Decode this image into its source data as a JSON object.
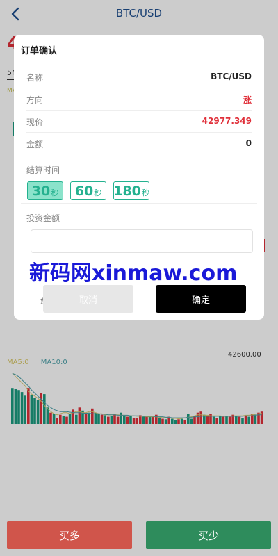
{
  "header": {
    "title": "BTC/USD",
    "back_icon": "chevron-left-icon"
  },
  "background": {
    "price_partial": "4",
    "period_partial": "5M",
    "ma_top_partial": "MA",
    "axis_label": "42600.00",
    "ma5_label": "MA5:0",
    "ma10_label": "MA10:0"
  },
  "volume_chart": {
    "type": "bar",
    "values": [
      70,
      68,
      66,
      62,
      55,
      70,
      56,
      50,
      46,
      60,
      58,
      32,
      22,
      20,
      12,
      18,
      15,
      14,
      20,
      28,
      18,
      32,
      26,
      20,
      22,
      30,
      22,
      20,
      18,
      17,
      14,
      16,
      20,
      14,
      22,
      15,
      14,
      16,
      12,
      12,
      17,
      14,
      15,
      14,
      14,
      18,
      12,
      10,
      9,
      14,
      10,
      8,
      9,
      10,
      8,
      20,
      10,
      16,
      22,
      24,
      18,
      16,
      20,
      14,
      12,
      16,
      14,
      15,
      14,
      18,
      16,
      14,
      12,
      16,
      14,
      20,
      18,
      22,
      24
    ],
    "colors": [
      "g",
      "g",
      "g",
      "g",
      "g",
      "r",
      "g",
      "g",
      "g",
      "r",
      "g",
      "g",
      "r",
      "g",
      "r",
      "r",
      "g",
      "r",
      "g",
      "r",
      "g",
      "r",
      "g",
      "r",
      "g",
      "r",
      "g",
      "g",
      "r",
      "g",
      "r",
      "g",
      "r",
      "r",
      "g",
      "g",
      "r",
      "g",
      "r",
      "r",
      "r",
      "g",
      "r",
      "g",
      "r",
      "r",
      "g",
      "r",
      "g",
      "r",
      "g",
      "g",
      "r",
      "g",
      "r",
      "g",
      "g",
      "r",
      "r",
      "r",
      "g",
      "r",
      "r",
      "g",
      "r",
      "g",
      "r",
      "g",
      "r",
      "r",
      "g",
      "r",
      "g",
      "r",
      "g",
      "r",
      "g",
      "r",
      "r"
    ],
    "ma5": [
      100,
      92,
      86,
      80,
      74,
      64,
      58,
      54,
      50,
      44,
      36,
      30,
      24,
      20,
      18,
      20,
      22,
      22,
      20,
      22,
      24,
      24,
      22,
      22,
      24,
      24,
      22,
      20,
      20,
      18,
      18,
      18,
      18,
      18,
      17,
      17,
      16,
      16,
      16,
      15,
      15,
      15,
      14,
      14,
      14,
      14,
      13,
      12,
      12,
      12,
      11,
      11,
      10,
      11,
      12,
      13,
      14,
      16,
      18,
      18,
      17,
      17,
      16,
      16,
      16,
      16,
      15,
      15,
      15,
      16,
      16,
      16,
      16,
      17,
      17,
      18,
      19,
      20,
      21
    ],
    "ma10": [
      98,
      96,
      92,
      86,
      80,
      74,
      66,
      60,
      54,
      48,
      42,
      36,
      32,
      28,
      26,
      24,
      24,
      24,
      23,
      22,
      22,
      22,
      21,
      21,
      21,
      20,
      20,
      20,
      19,
      19,
      18,
      18,
      18,
      17,
      17,
      17,
      17,
      16,
      16,
      16,
      16,
      15,
      15,
      15,
      15,
      14,
      14,
      14,
      13,
      13,
      12,
      12,
      12,
      12,
      12,
      13,
      13,
      14,
      14,
      15,
      15,
      15,
      15,
      15,
      15,
      15,
      15,
      15,
      15,
      15,
      15,
      15,
      15,
      16,
      16,
      16,
      17,
      18,
      18
    ]
  },
  "modal": {
    "title": "订单确认",
    "rows": [
      {
        "label": "名称",
        "value": "BTC/USD"
      },
      {
        "label": "方向",
        "value": "涨"
      },
      {
        "label": "现价",
        "value": "42977.349"
      },
      {
        "label": "金额",
        "value": "0"
      }
    ],
    "settle_time_label": "结算时间",
    "time_options": [
      {
        "value": "30",
        "unit": "秒",
        "selected": true
      },
      {
        "value": "60",
        "unit": "秒",
        "selected": false
      },
      {
        "value": "180",
        "unit": "秒",
        "selected": false
      }
    ],
    "invest_amount_label": "投资金额",
    "amount_value": "",
    "amount_placeholder": "",
    "hidden_label_partial": "余额",
    "cancel_label": "取消",
    "confirm_label": "确定"
  },
  "watermark": "新码网xinmaw.com",
  "bottom": {
    "buy_long": "买多",
    "buy_short": "买少"
  },
  "colors": {
    "rise": "#e0303a",
    "fall": "#1b9b80",
    "accent": "#24b18f",
    "header_text": "#1f4f8f",
    "buy_long_bg": "#d0554b",
    "buy_short_bg": "#2e8c5c"
  }
}
